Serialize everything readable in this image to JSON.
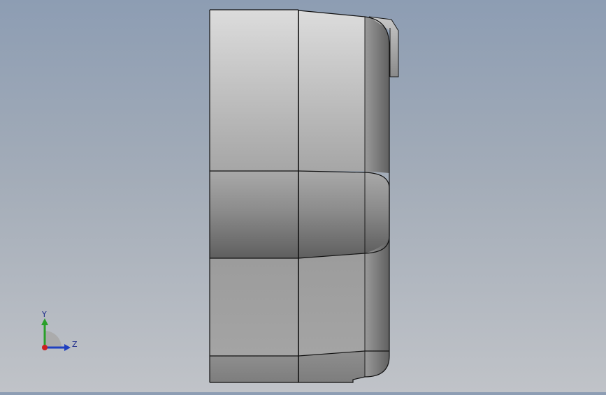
{
  "view": {
    "background_top": "#8d9db3",
    "background_bottom": "#c0c3c8",
    "model_name": ""
  },
  "triad": {
    "y_label": "Y",
    "z_label": "Z",
    "y_color": "#2aa02a",
    "z_color": "#2040c0",
    "x_color": "#cc2020"
  }
}
